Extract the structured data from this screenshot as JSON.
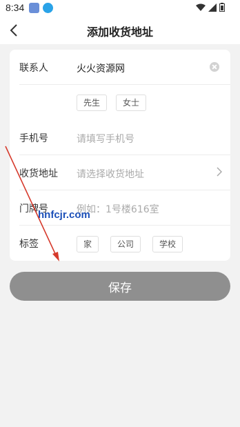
{
  "status_bar": {
    "time": "8:34"
  },
  "header": {
    "title": "添加收货地址"
  },
  "form": {
    "contact": {
      "label": "联系人",
      "value": "火火资源网"
    },
    "gender": {
      "options": [
        "先生",
        "女士"
      ]
    },
    "phone": {
      "label": "手机号",
      "placeholder": "请填写手机号"
    },
    "address": {
      "label": "收货地址",
      "placeholder": "请选择收货地址"
    },
    "door": {
      "label": "门牌号",
      "placeholder": "例如：1号楼616室"
    },
    "tags": {
      "label": "标签",
      "options": [
        "家",
        "公司",
        "学校"
      ]
    }
  },
  "save_label": "保存",
  "watermark": "hnfcjr.com",
  "colors": {
    "save_bg": "#8f8f8f",
    "annotation": "#d63a2c"
  }
}
